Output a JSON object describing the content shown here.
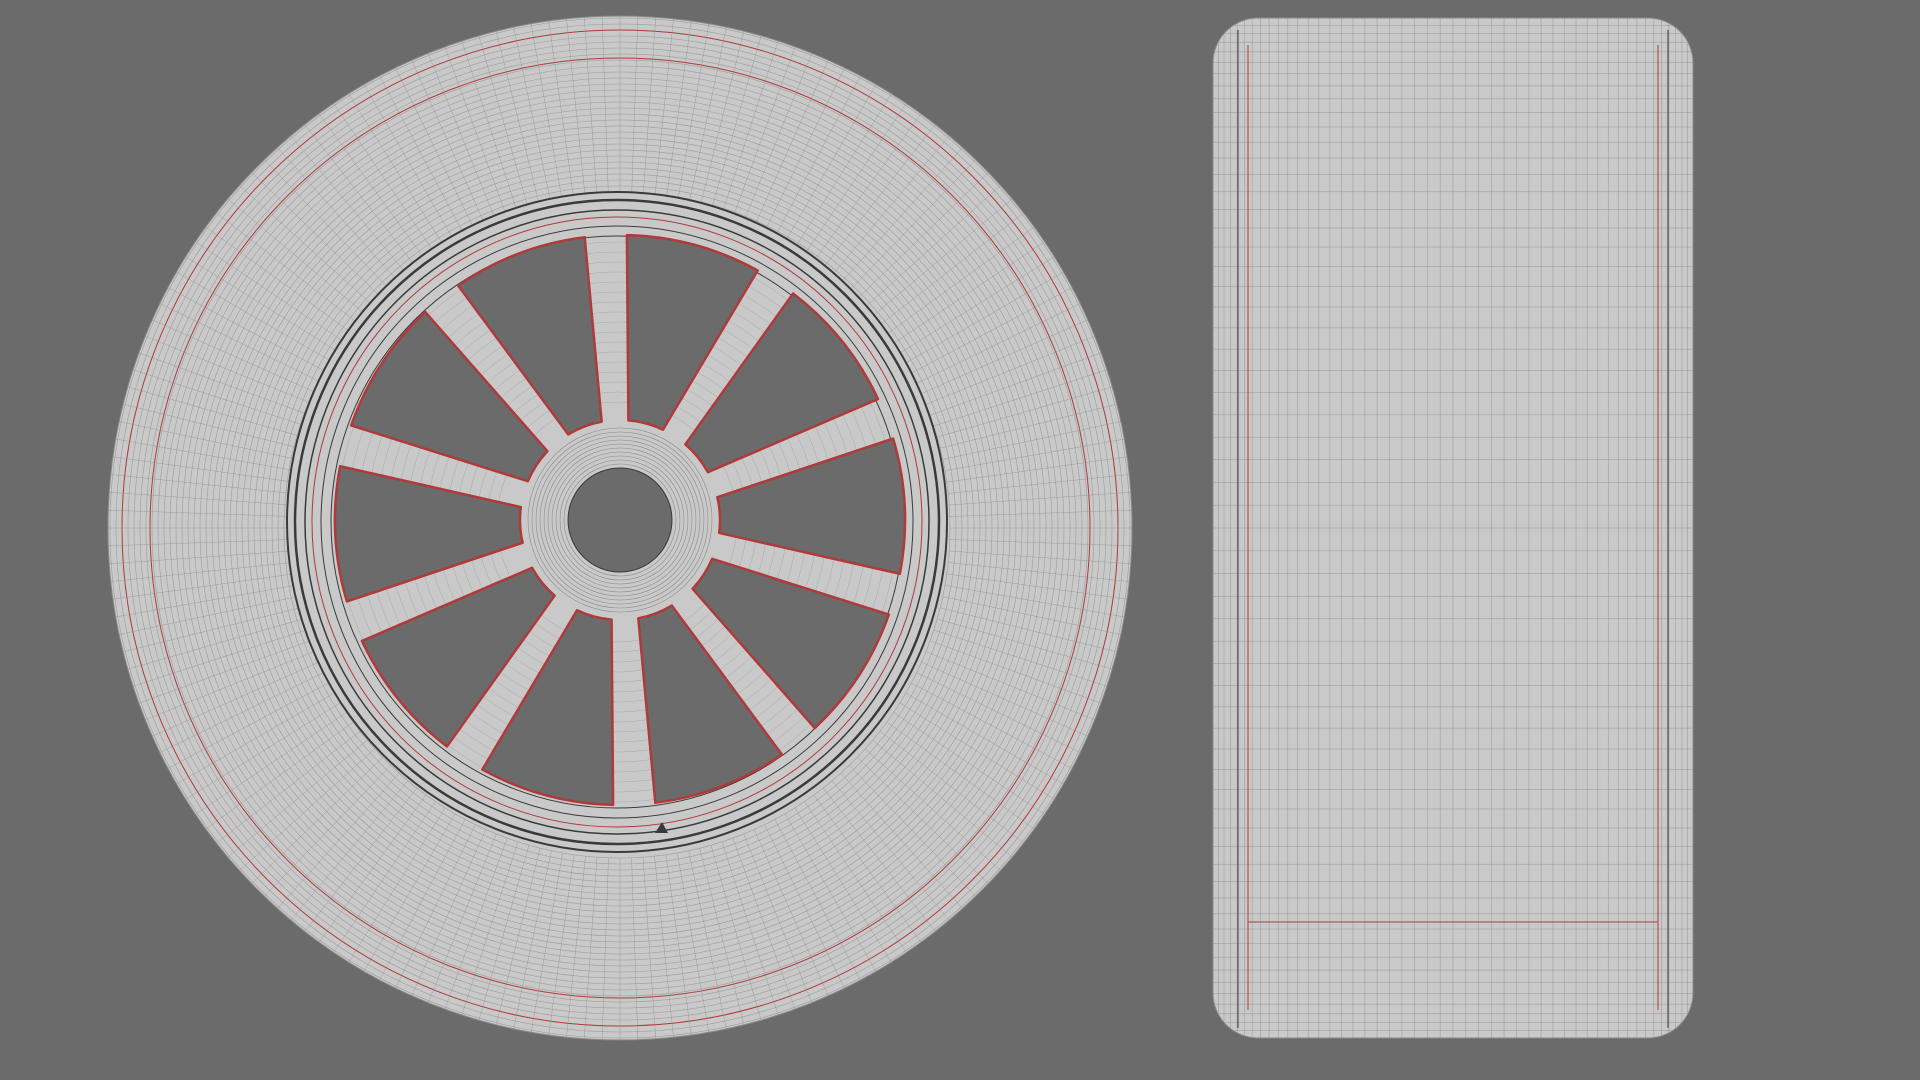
{
  "viewport": {
    "background_color": "#6b6b6b",
    "views": [
      {
        "name": "front-view",
        "object": "wheel",
        "spoke_count": 10
      },
      {
        "name": "side-view",
        "object": "tire"
      }
    ]
  },
  "colors": {
    "mesh_fill": "#c9c9c9",
    "wire_fine": "#8a8a8a",
    "wire_dark": "#3a3a3a",
    "seam_red": "#b03a3a",
    "hole_fill": "#6b6b6b"
  }
}
